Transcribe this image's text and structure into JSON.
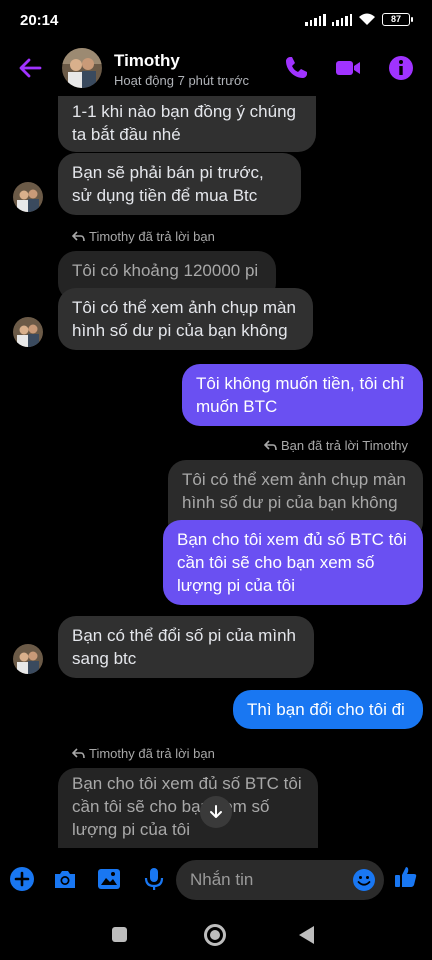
{
  "status": {
    "time": "20:14",
    "battery": "87"
  },
  "header": {
    "name": "Timothy",
    "subtitle": "Hoạt động 7 phút trước"
  },
  "messages": {
    "m1_partial": "1-1 khi nào bạn đồng ý chúng ta bắt đầu nhé",
    "m2": "Bạn sẽ phải bán pi trước, sử dụng tiền để mua Btc",
    "reply1_label": "Timothy đã trả lời bạn",
    "m3_quoted": "Tôi có khoảng 120000 pi",
    "m4": "Tôi có thể xem ảnh chụp màn hình số dư pi của bạn không",
    "m5": "Tôi không muốn tiền, tôi chỉ muốn BTC",
    "reply2_label": "Bạn đã trả lời Timothy",
    "m6_quoted": "Tôi có thể xem ảnh chụp màn hình số dư pi của bạn không",
    "m7": "Bạn cho tôi xem đủ số BTC tôi cần tôi sẽ cho bạn xem số lượng pi của tôi",
    "m8": "Bạn có thể đổi số pi của mình sang btc",
    "m9": "Thì bạn đổi cho tôi đi",
    "reply3_label": "Timothy đã trả lời bạn",
    "m10_quoted": "Bạn cho tôi xem đủ số BTC tôi cần tôi sẽ cho bạn xem số lượng pi của tôi"
  },
  "composer": {
    "placeholder": "Nhắn tin"
  },
  "colors": {
    "accent": "#a033ff",
    "outgoing": "#6a50f2",
    "outgoing_blue": "#1977f2",
    "incoming": "#303030"
  },
  "icons": [
    "back-arrow-icon",
    "phone-icon",
    "video-icon",
    "info-icon",
    "plus-icon",
    "camera-icon",
    "image-icon",
    "mic-icon",
    "emoji-icon",
    "thumbs-up-icon",
    "scroll-down-icon"
  ]
}
